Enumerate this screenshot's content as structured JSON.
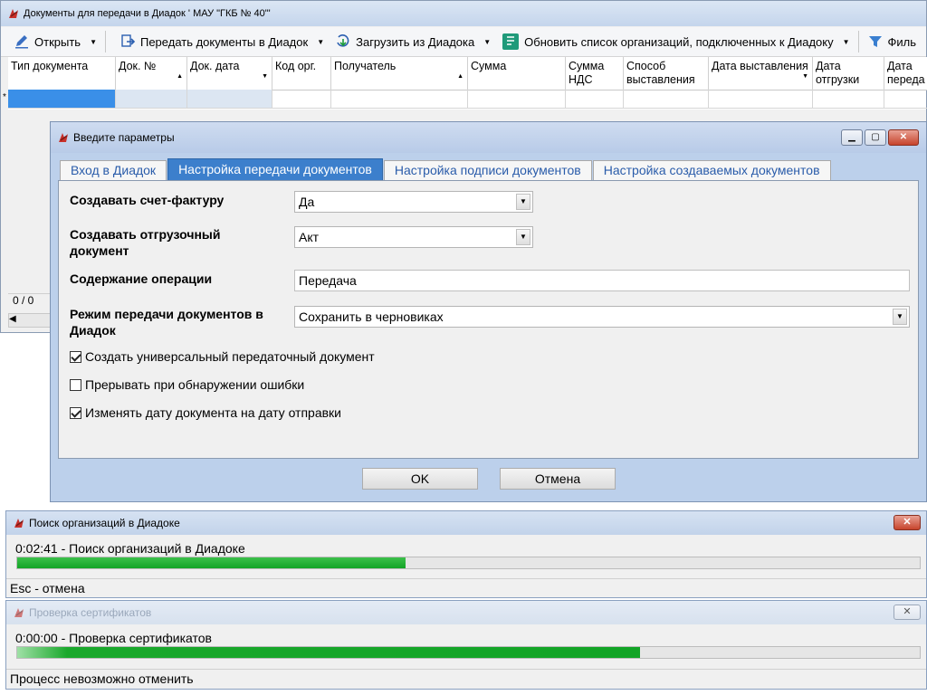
{
  "main": {
    "title": "Документы для передачи в Диадок  ' МАУ \"ГКБ № 40\"'",
    "toolbar": {
      "open": "Открыть",
      "send": "Передать документы в Диадок",
      "load": "Загрузить из Диадока",
      "refresh": "Обновить список организаций, подключенных к Диадоку",
      "filter": "Филь"
    },
    "columns": [
      "Тип документа",
      "Док. №",
      "Док. дата",
      "Код орг.",
      "Получатель",
      "Сумма",
      "Сумма НДС",
      "Способ выставления",
      "Дата выставления",
      "Дата отгрузки",
      "Дата переда"
    ],
    "row_marker": "*",
    "status": "0 / 0"
  },
  "dialog": {
    "title": "Введите параметры",
    "tabs": [
      "Вход в Диадок",
      "Настройка передачи документов",
      "Настройка подписи документов",
      "Настройка создаваемых документов"
    ],
    "fields": {
      "invoice_label": "Создавать счет-фактуру",
      "invoice_value": "Да",
      "shipping_label": "Создавать отгрузочный документ",
      "shipping_value": "Акт",
      "operation_label": "Содержание операции",
      "operation_value": "Передача",
      "mode_label": "Режим передачи документов в Диадок",
      "mode_value": "Сохранить в черновиках"
    },
    "checks": [
      {
        "label": "Создать универсальный передаточный документ",
        "checked": true
      },
      {
        "label": "Прерывать при обнаружении ошибки",
        "checked": false
      },
      {
        "label": "Изменять дату документа на дату отправки",
        "checked": true
      }
    ],
    "ok": "OK",
    "cancel": "Отмена"
  },
  "progress1": {
    "title": "Поиск организаций в Диадоке",
    "text": "0:02:41 - Поиск организаций в Диадоке",
    "progress": 0.43,
    "footer": "Esc - отмена"
  },
  "progress2": {
    "title": "Проверка сертификатов",
    "text": "0:00:00 - Проверка сертификатов",
    "progress": 0.69,
    "footer": "Процесс невозможно отменить"
  },
  "colors": {
    "accent": "#3c7fcc",
    "progress": "#12a426",
    "close": "#c7442c"
  },
  "icons": [
    "app-icon",
    "edit-icon",
    "send-icon",
    "download-icon",
    "refresh-list-icon",
    "filter-icon",
    "checkbox-icon",
    "close-icon",
    "minimize-icon",
    "maximize-icon"
  ]
}
